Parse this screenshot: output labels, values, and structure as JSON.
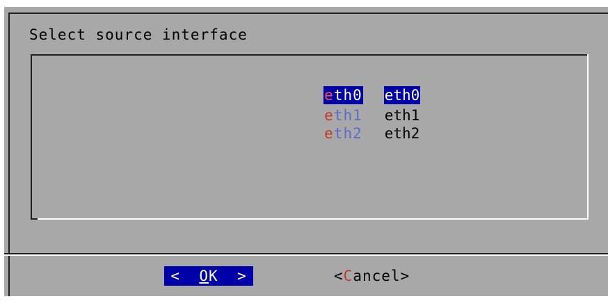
{
  "dialog": {
    "title": "Select source interface"
  },
  "menu": {
    "items": [
      {
        "tag_hot": "e",
        "tag_rest": "th0",
        "description": "eth0",
        "selected": true
      },
      {
        "tag_hot": "e",
        "tag_rest": "th1",
        "description": "eth1",
        "selected": false
      },
      {
        "tag_hot": "e",
        "tag_rest": "th2",
        "description": "eth2",
        "selected": false
      }
    ]
  },
  "buttons": {
    "ok": {
      "left": "<  ",
      "hot": "O",
      "rest": "K",
      "right": "  >"
    },
    "cancel": {
      "left": "<",
      "hot": "C",
      "rest": "ancel",
      "right": ">"
    }
  },
  "colors": {
    "dialog_background": "#a8a8a8",
    "selection_background": "#0000a8",
    "hotkey": "#c0392b",
    "tag_text": "#5a6cc8"
  }
}
